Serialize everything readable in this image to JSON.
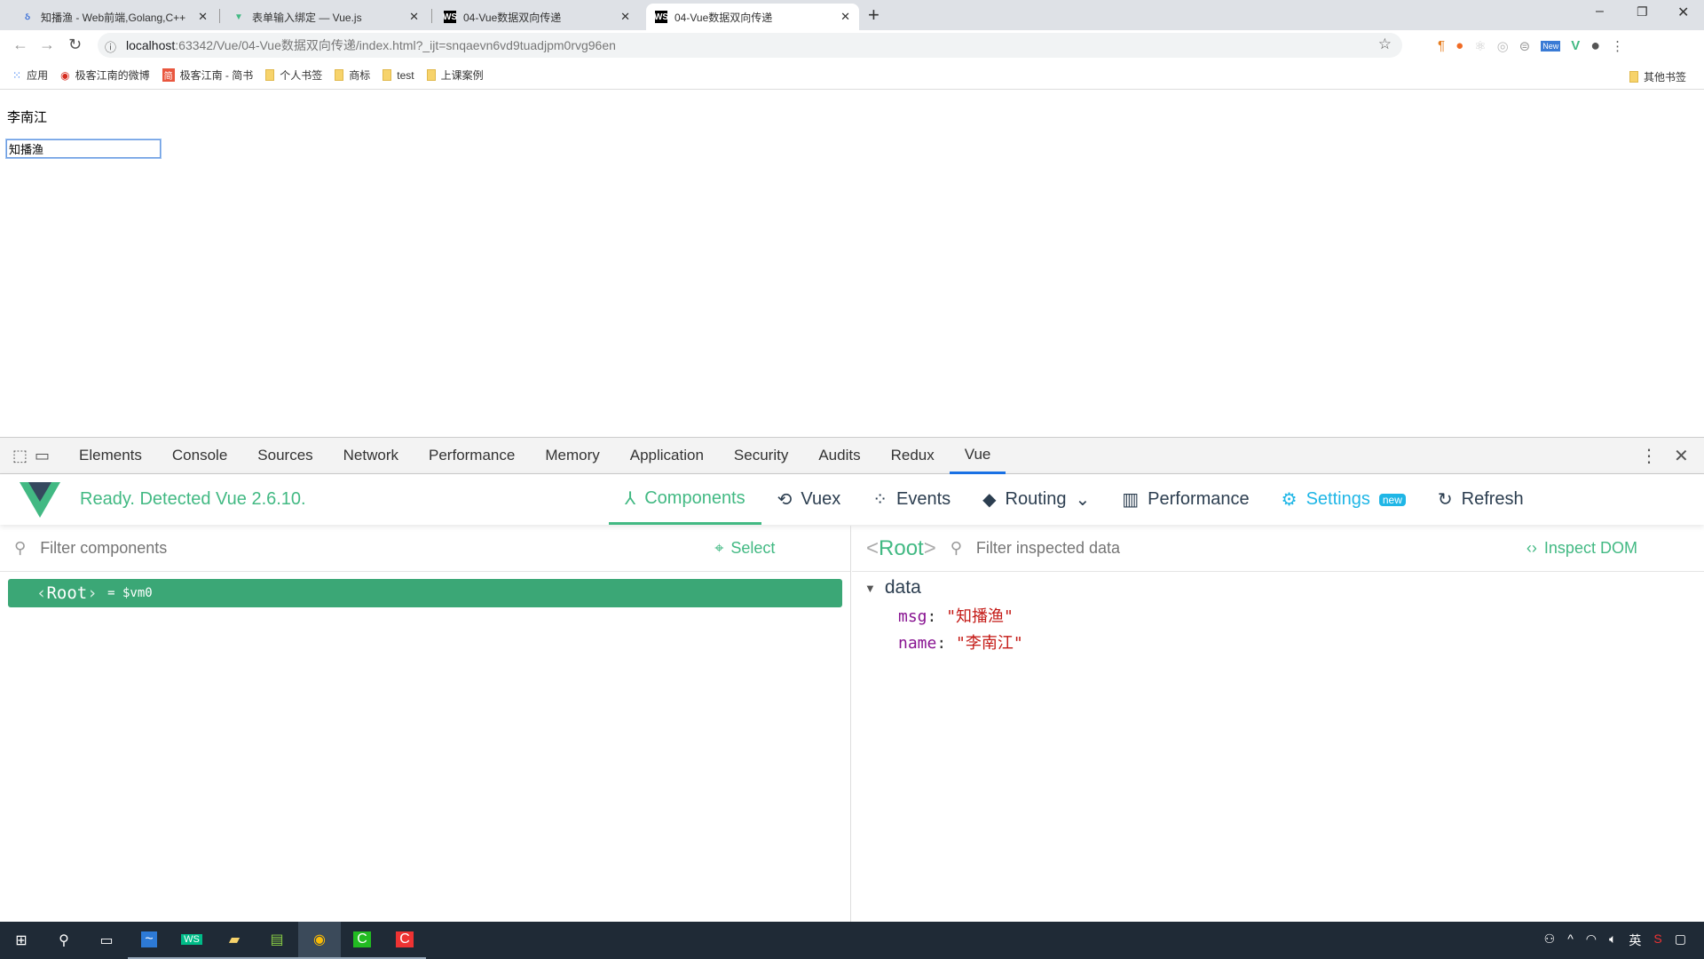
{
  "browser": {
    "tabs": [
      {
        "title": "知播渔 - Web前端,Golang,C++",
        "icon": "zhiboyu-icon"
      },
      {
        "title": "表单输入绑定 — Vue.js",
        "icon": "vue-icon"
      },
      {
        "title": "04-Vue数据双向传递",
        "icon": "webstorm-icon"
      },
      {
        "title": "04-Vue数据双向传递",
        "icon": "webstorm-icon",
        "active": true
      }
    ],
    "url_host": "localhost",
    "url_rest": ":63342/Vue/04-Vue数据双向传递/index.html?_ijt=snqaevn6vd9tuadjpm0rvg96en",
    "bookmarks": [
      "应用",
      "极客江南的微博",
      "极客江南 - 简书",
      "个人书签",
      "商标",
      "test",
      "上课案例"
    ],
    "other_bookmarks": "其他书签",
    "ext_new_badge": "New"
  },
  "page": {
    "name_text": "李南江",
    "input_value": "知播渔"
  },
  "devtools": {
    "tabs": [
      "Elements",
      "Console",
      "Sources",
      "Network",
      "Performance",
      "Memory",
      "Application",
      "Security",
      "Audits",
      "Redux",
      "Vue"
    ],
    "active_tab": "Vue",
    "vue": {
      "status": "Ready. Detected Vue 2.6.10.",
      "nav": [
        "Components",
        "Vuex",
        "Events",
        "Routing",
        "Performance",
        "Settings",
        "Refresh"
      ],
      "settings_badge": "new",
      "filter_components_placeholder": "Filter components",
      "select_label": "Select",
      "root_tag": "Root",
      "root_var": "= $vm0",
      "inspect_title": "Root",
      "filter_data_placeholder": "Filter inspected data",
      "inspect_dom": "Inspect DOM",
      "data_section": "data",
      "data": [
        {
          "key": "msg",
          "value": "\"知播渔\""
        },
        {
          "key": "name",
          "value": "\"李南江\""
        }
      ]
    },
    "colors": {
      "vue_green": "#42b983",
      "settings_blue": "#1fb6e6",
      "string_red": "#c41a16",
      "key_purple": "#881391"
    }
  },
  "tray": {
    "ime": "英"
  }
}
